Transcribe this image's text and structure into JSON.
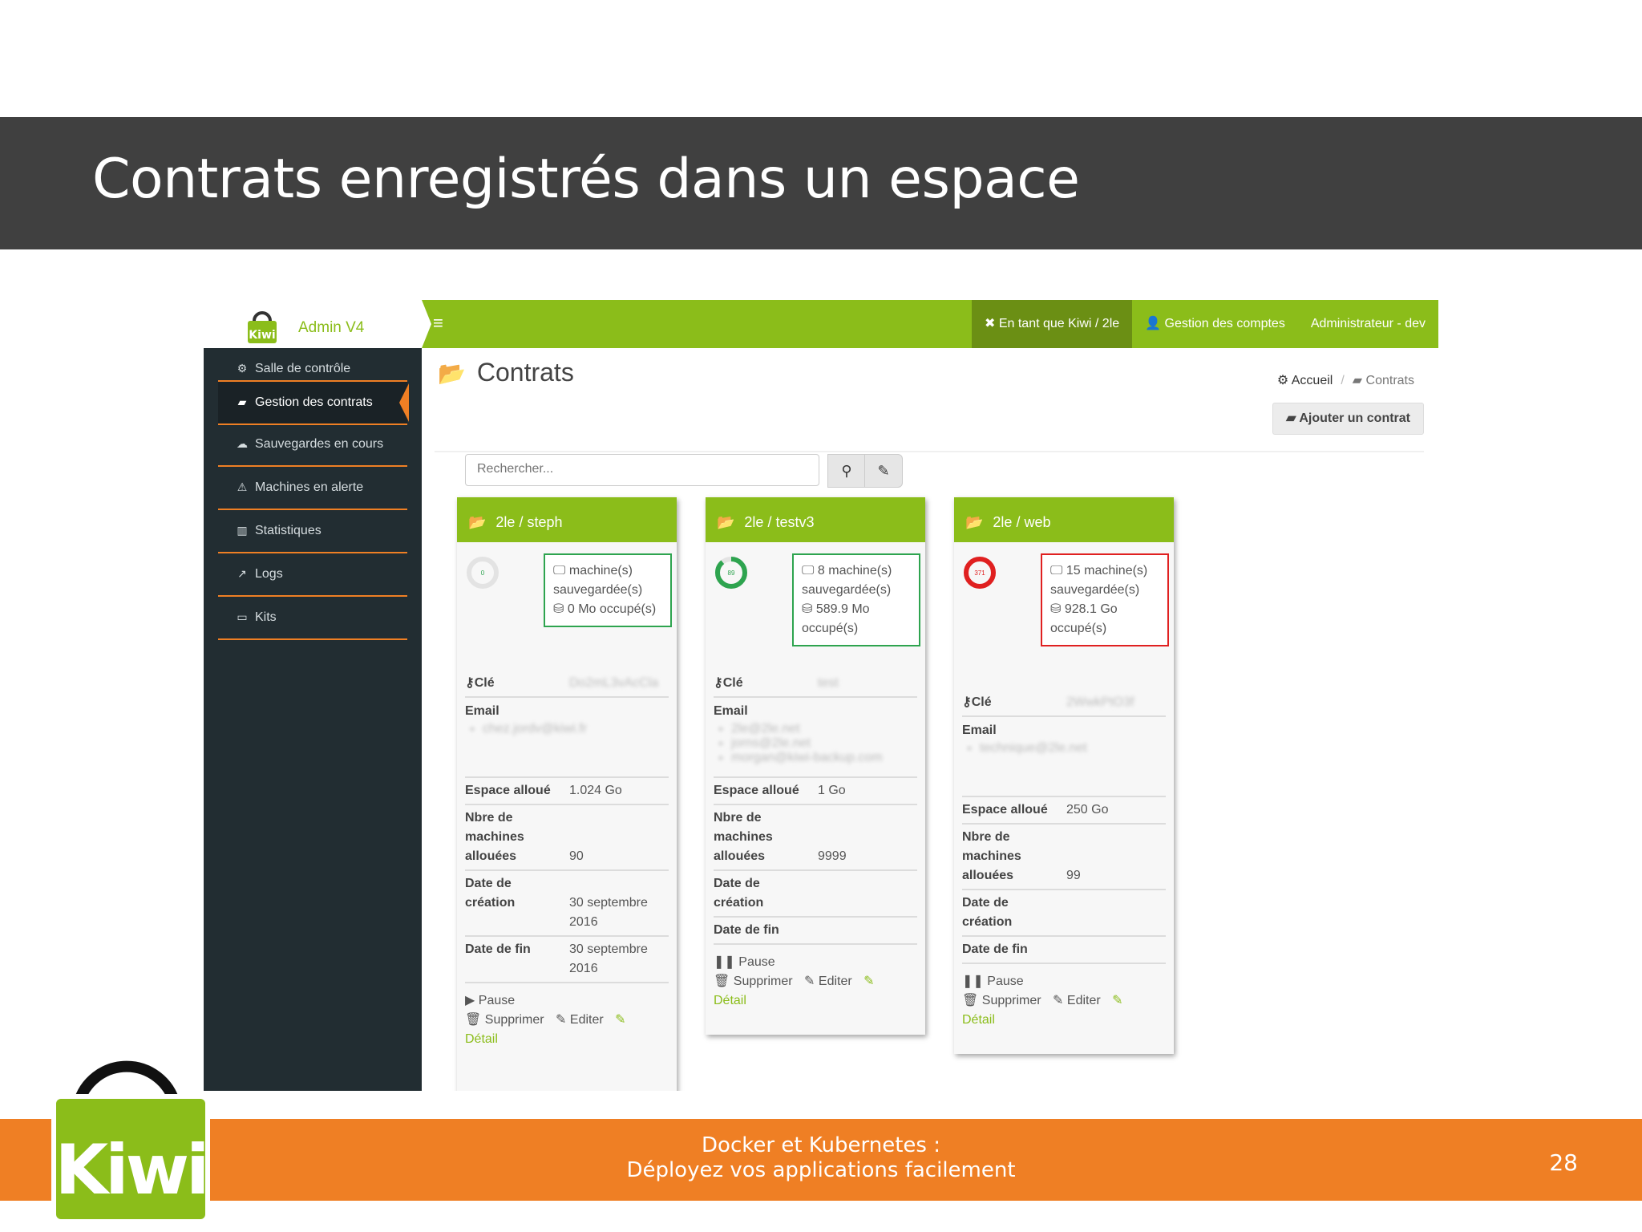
{
  "slide": {
    "title": "Contrats enregistrés dans un espace",
    "footer_line1": "Docker et Kubernetes :",
    "footer_line2": "Déployez vos applications facilement",
    "page_number": "28",
    "logo_text": "Kiwi"
  },
  "colors": {
    "green": "#8bbd1a",
    "orange": "#ef7f24",
    "dark": "#222d32",
    "title_band": "#404040"
  },
  "app": {
    "brand": "Admin V4",
    "topbar": {
      "menu_icon": "hamburger-icon",
      "impersonate": "En tant que Kiwi / 2le",
      "accounts": "Gestion des comptes",
      "user": "Administrateur - dev"
    },
    "sidebar": {
      "items": [
        {
          "label": "Salle de contrôle",
          "icon": "dashboard-icon",
          "glyph": "⚙"
        },
        {
          "label": "Gestion des contrats",
          "icon": "folder-open-icon",
          "glyph": "▰"
        },
        {
          "label": "Sauvegardes en cours",
          "icon": "cloud-upload-icon",
          "glyph": "☁"
        },
        {
          "label": "Machines en alerte",
          "icon": "warning-icon",
          "glyph": "⚠"
        },
        {
          "label": "Statistiques",
          "icon": "bar-chart-icon",
          "glyph": "▥"
        },
        {
          "label": "Logs",
          "icon": "line-chart-icon",
          "glyph": "↗"
        },
        {
          "label": "Kits",
          "icon": "drive-icon",
          "glyph": "▭"
        }
      ]
    },
    "page": {
      "title": "Contrats",
      "breadcrumb_home": "Accueil",
      "breadcrumb_current": "Contrats",
      "add_button": "Ajouter un contrat",
      "search_placeholder": "Rechercher..."
    },
    "labels": {
      "key": "Clé",
      "email": "Email",
      "space": "Espace alloué",
      "machines_1": "Nbre de",
      "machines_2": "machines",
      "machines_3": "allouées",
      "created_1": "Date de",
      "created_2": "création",
      "end": "Date de fin",
      "delete": "Supprimer",
      "edit": "Editer",
      "detail": "Détail",
      "machines_saved": "machine(s) sauvegardée(s)",
      "occupied": "occupé(s)"
    },
    "cards": [
      {
        "title": "2le / steph",
        "gauge_label": "0",
        "gauge_level": 0,
        "gauge_color": "#cccccc",
        "machines_count": "",
        "storage": "0 Mo",
        "key_value": "Do2mL3vAcCla",
        "emails": [
          "chez.jordv@kiwi.fr"
        ],
        "space": "1.024 Go",
        "machines_allowed": "90",
        "created": "30 septembre 2016",
        "end": "30 septembre 2016",
        "state_action": "Pause",
        "state_glyph": "▶"
      },
      {
        "title": "2le / testv3",
        "gauge_label": "89",
        "gauge_level": 0.89,
        "gauge_color": "#2ea44f",
        "machines_count": "8",
        "storage": "589.9 Mo",
        "key_value": "test",
        "emails": [
          "2le@2le.net",
          "jorns@2le.net",
          "morgan@kiwi-backup.com"
        ],
        "space": "1 Go",
        "machines_allowed": "9999",
        "created": "",
        "end": "",
        "state_action": "Pause",
        "state_glyph": "❚❚"
      },
      {
        "title": "2le / web",
        "gauge_label": "371",
        "gauge_level": 1,
        "gauge_color": "#e02020",
        "machines_count": "15",
        "storage": "928.1 Go",
        "key_value": "2WwkPtO3f",
        "emails": [
          "technique@2le.net"
        ],
        "space": "250 Go",
        "machines_allowed": "99",
        "created": "",
        "end": "",
        "state_action": "Pause",
        "state_glyph": "❚❚"
      }
    ]
  }
}
